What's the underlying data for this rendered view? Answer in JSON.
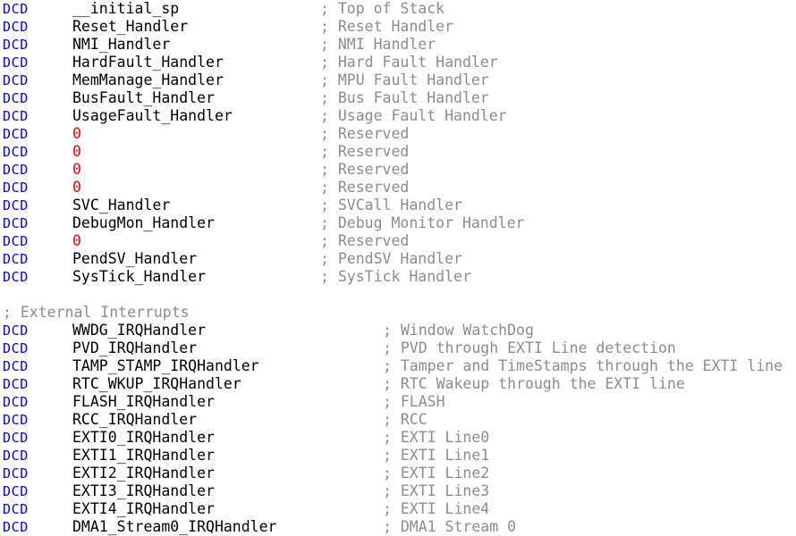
{
  "editor": {
    "language": "ARM Assembly",
    "colors": {
      "directive": "#0000ff",
      "operand": "#000000",
      "number": "#ff0000",
      "comment": "#8c8c8c",
      "background": "#ffffff"
    },
    "directive_keyword": "DCD",
    "comment_prefix": ";"
  },
  "sections": [
    {
      "name": "core-vector-table",
      "comment_column": "col-a",
      "lines": [
        {
          "directive": "DCD",
          "operand": "__initial_sp",
          "operand_kind": "symbol",
          "comment": "; Top of Stack"
        },
        {
          "directive": "DCD",
          "operand": "Reset_Handler",
          "operand_kind": "symbol",
          "comment": "; Reset Handler"
        },
        {
          "directive": "DCD",
          "operand": "NMI_Handler",
          "operand_kind": "symbol",
          "comment": "; NMI Handler"
        },
        {
          "directive": "DCD",
          "operand": "HardFault_Handler",
          "operand_kind": "symbol",
          "comment": "; Hard Fault Handler"
        },
        {
          "directive": "DCD",
          "operand": "MemManage_Handler",
          "operand_kind": "symbol",
          "comment": "; MPU Fault Handler"
        },
        {
          "directive": "DCD",
          "operand": "BusFault_Handler",
          "operand_kind": "symbol",
          "comment": "; Bus Fault Handler"
        },
        {
          "directive": "DCD",
          "operand": "UsageFault_Handler",
          "operand_kind": "symbol",
          "comment": "; Usage Fault Handler"
        },
        {
          "directive": "DCD",
          "operand": "0",
          "operand_kind": "number",
          "comment": "; Reserved"
        },
        {
          "directive": "DCD",
          "operand": "0",
          "operand_kind": "number",
          "comment": "; Reserved"
        },
        {
          "directive": "DCD",
          "operand": "0",
          "operand_kind": "number",
          "comment": "; Reserved"
        },
        {
          "directive": "DCD",
          "operand": "0",
          "operand_kind": "number",
          "comment": "; Reserved"
        },
        {
          "directive": "DCD",
          "operand": "SVC_Handler",
          "operand_kind": "symbol",
          "comment": "; SVCall Handler"
        },
        {
          "directive": "DCD",
          "operand": "DebugMon_Handler",
          "operand_kind": "symbol",
          "comment": "; Debug Monitor Handler"
        },
        {
          "directive": "DCD",
          "operand": "0",
          "operand_kind": "number",
          "comment": "; Reserved"
        },
        {
          "directive": "DCD",
          "operand": "PendSV_Handler",
          "operand_kind": "symbol",
          "comment": "; PendSV Handler"
        },
        {
          "directive": "DCD",
          "operand": "SysTick_Handler",
          "operand_kind": "symbol",
          "comment": "; SysTick Handler"
        }
      ]
    },
    {
      "name": "blank-separator",
      "blank_lines": 1
    },
    {
      "name": "external-interrupts",
      "header_comment": "; External Interrupts",
      "comment_column": "col-b",
      "lines": [
        {
          "directive": "DCD",
          "operand": "WWDG_IRQHandler",
          "operand_kind": "symbol",
          "comment": "; Window WatchDog"
        },
        {
          "directive": "DCD",
          "operand": "PVD_IRQHandler",
          "operand_kind": "symbol",
          "comment": "; PVD through EXTI Line detection"
        },
        {
          "directive": "DCD",
          "operand": "TAMP_STAMP_IRQHandler",
          "operand_kind": "symbol",
          "comment": "; Tamper and TimeStamps through the EXTI line"
        },
        {
          "directive": "DCD",
          "operand": "RTC_WKUP_IRQHandler",
          "operand_kind": "symbol",
          "comment": "; RTC Wakeup through the EXTI line"
        },
        {
          "directive": "DCD",
          "operand": "FLASH_IRQHandler",
          "operand_kind": "symbol",
          "comment": "; FLASH"
        },
        {
          "directive": "DCD",
          "operand": "RCC_IRQHandler",
          "operand_kind": "symbol",
          "comment": "; RCC"
        },
        {
          "directive": "DCD",
          "operand": "EXTI0_IRQHandler",
          "operand_kind": "symbol",
          "comment": "; EXTI Line0"
        },
        {
          "directive": "DCD",
          "operand": "EXTI1_IRQHandler",
          "operand_kind": "symbol",
          "comment": "; EXTI Line1"
        },
        {
          "directive": "DCD",
          "operand": "EXTI2_IRQHandler",
          "operand_kind": "symbol",
          "comment": "; EXTI Line2"
        },
        {
          "directive": "DCD",
          "operand": "EXTI3_IRQHandler",
          "operand_kind": "symbol",
          "comment": "; EXTI Line3"
        },
        {
          "directive": "DCD",
          "operand": "EXTI4_IRQHandler",
          "operand_kind": "symbol",
          "comment": "; EXTI Line4"
        },
        {
          "directive": "DCD",
          "operand": "DMA1_Stream0_IRQHandler",
          "operand_kind": "symbol",
          "comment": "; DMA1 Stream 0"
        }
      ]
    }
  ]
}
